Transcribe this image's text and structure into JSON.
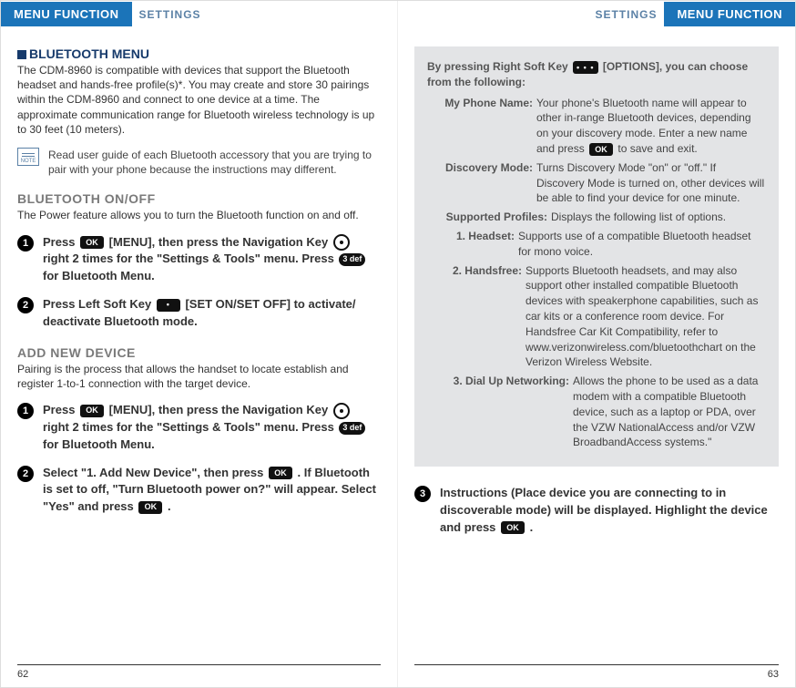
{
  "tabs": {
    "menu_function": "MENU FUNCTION",
    "settings": "SETTINGS"
  },
  "left": {
    "section_title": "BLUETOOTH MENU",
    "intro": "The CDM-8960 is compatible with devices that support the Bluetooth headset and hands-free profile(s)*. You may create and store 30 pairings within the CDM-8960 and connect to one device at a time. The approximate communication range for Bluetooth wireless technology is up to 30 feet (10 meters).",
    "note_label": "NOTE",
    "note": "Read user guide of each Bluetooth accessory that you are trying to pair with your phone because the instructions may different.",
    "onoff_h": "BLUETOOTH ON/OFF",
    "onoff_txt": "The Power feature allows you to turn the Bluetooth function on and off.",
    "keys": {
      "ok": "OK",
      "menu_pre": "Press ",
      "menu_post": " [MENU], then press the Navigation Key ",
      "right2": " right 2 times for the \"Settings & Tools\" menu. Press ",
      "three_def": "3  def",
      "for_bt": " for Bluetooth Menu."
    },
    "step_onoff_2_a": "Press Left Soft Key ",
    "step_onoff_2_b": " [SET ON/SET OFF] to activate/ deactivate Bluetooth mode.",
    "dot": "•",
    "add_h": "ADD NEW DEVICE",
    "add_txt": "Pairing is the process that allows the handset to locate establish and register 1-to-1 connection with the target device.",
    "add_s2_a": "Select \"1. Add New Device\", then press ",
    "add_s2_b": " . If Bluetooth is set to off, \"Turn Bluetooth power on?\" will appear. Select \"Yes\" and press ",
    "add_s2_c": " .",
    "page_num": "62"
  },
  "right": {
    "gb_intro_a": "By pressing Right Soft Key ",
    "gb_intro_dots": "• • •",
    "gb_intro_b": " [OPTIONS], you can choose from the following:",
    "rows": {
      "my_phone_name_l": "My Phone Name:",
      "my_phone_name_r_a": "Your phone's Bluetooth name will appear to other in-range Bluetooth devices, depending on your discovery mode. Enter a new name and press ",
      "my_phone_name_r_b": " to save and exit.",
      "discovery_l": "Discovery Mode:",
      "discovery_r": "Turns Discovery Mode \"on\" or \"off.\" If Discovery Mode is turned on, other devices will be able to find your device for one minute.",
      "supported_l": "Supported Profiles:",
      "supported_r": "Displays the following list of options.",
      "headset_l": "1. Headset:",
      "headset_r": "Supports use of a compatible Bluetooth headset for mono voice.",
      "handsfree_l": "2. Handsfree:",
      "handsfree_r": "Supports Bluetooth headsets, and may also support other installed compatible Bluetooth devices with speakerphone capabilities, such as car kits or a conference room device. For Handsfree Car Kit Compatibility, refer to www.verizonwireless.com/bluetoothchart on the Verizon Wireless Website.",
      "dun_l": "3. Dial Up Networking:",
      "dun_r": "Allows the phone to be used as a data modem with a compatible Bluetooth device, such as a laptop or PDA, over the VZW NationalAccess and/or VZW BroadbandAccess systems.\""
    },
    "step3_a": "Instructions (Place device you are connecting to in discoverable mode) will be displayed. Highlight the device and press ",
    "step3_b": " .",
    "page_num": "63"
  }
}
